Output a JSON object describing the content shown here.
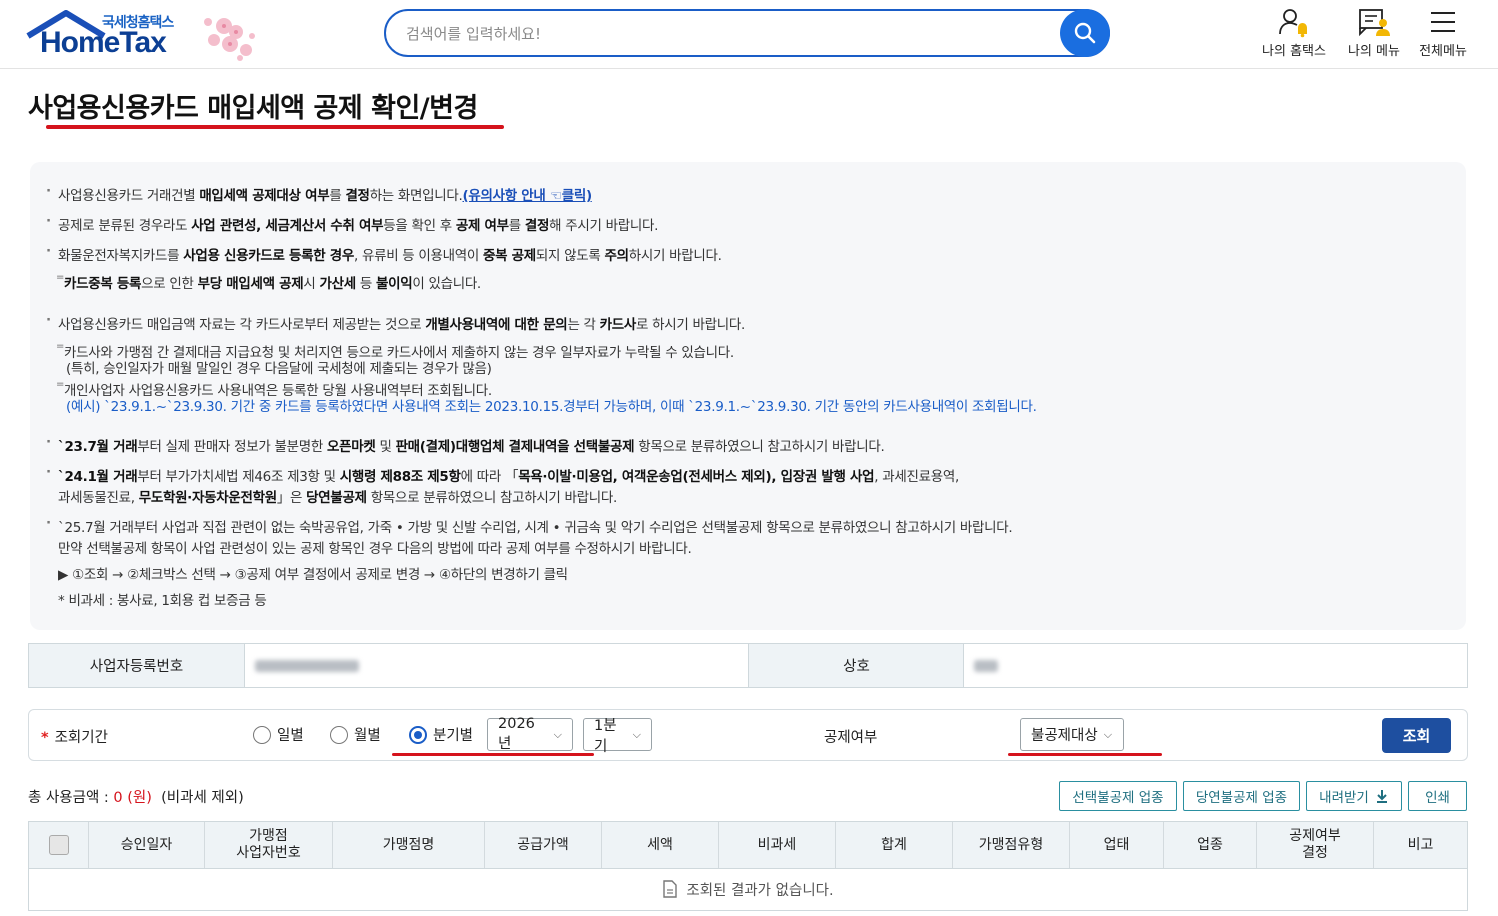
{
  "header": {
    "logo_small": "국세청홈택스",
    "logo_big": "HomeTax",
    "search_placeholder": "검색어를 입력하세요!",
    "nav": [
      {
        "label": "나의 홈택스",
        "icon": "user-bell-icon"
      },
      {
        "label": "나의 메뉴",
        "icon": "my-menu-icon"
      },
      {
        "label": "전체메뉴",
        "icon": "hamburger-menu-icon"
      }
    ]
  },
  "page": {
    "title": "사업용신용카드 매입세액 공제 확인/변경"
  },
  "notice": {
    "l1_a": "사업용신용카드 거래건별 ",
    "l1_b": "매입세액 공제대상 여부",
    "l1_c": "를 ",
    "l1_d": "결정",
    "l1_e": "하는 화면입니다.",
    "l1_link": "(유의사항 안내 ☜클릭)",
    "l2_a": "공제로 분류된 경우라도 ",
    "l2_b": "사업 관련성, 세금계산서 수취 여부",
    "l2_c": "등을 확인 후 ",
    "l2_d": "공제 여부",
    "l2_e": "를 ",
    "l2_f": "결정",
    "l2_g": "해 주시기 바랍니다.",
    "l3_a": "화물운전자복지카드를 ",
    "l3_b": "사업용 신용카드로 등록한 경우",
    "l3_c": ", 유류비 등 이용내역이 ",
    "l3_d": "중복 공제",
    "l3_e": "되지 않도록 ",
    "l3_f": "주의",
    "l3_g": "하시기 바랍니다.",
    "l4_a": "카드중복 등록",
    "l4_b": "으로 인한 ",
    "l4_c": "부당 매입세액 공제",
    "l4_d": "시 ",
    "l4_e": "가산세",
    "l4_f": " 등 ",
    "l4_g": "불이익",
    "l4_h": "이 있습니다.",
    "l5_a": "사업용신용카드 매입금액 자료는 각 카드사로부터 제공받는 것으로 ",
    "l5_b": "개별사용내역에 대한 문의",
    "l5_c": "는 각 ",
    "l5_d": "카드사",
    "l5_e": "로 하시기 바랍니다.",
    "l6": "카드사와 가맹점 간 결제대금 지급요청 및 처리지연 등으로 카드사에서 제출하지 않는 경우 일부자료가 누락될 수 있습니다.",
    "l7": "(특히, 승인일자가 매월 말일인 경우 다음달에 국세청에 제출되는 경우가 많음)",
    "l8": "개인사업자 사업용신용카드 사용내역은 등록한 당월 사용내역부터 조회됩니다.",
    "l9": "(예시) `23.9.1.~`23.9.30. 기간 중 카드를 등록하였다면 사용내역 조회는 2023.10.15.경부터 가능하며, 이때 `23.9.1.~`23.9.30. 기간 동안의 카드사용내역이 조회됩니다.",
    "l10_a": "`23.7월 거래",
    "l10_b": "부터 실제 판매자 정보가 불분명한 ",
    "l10_c": "오픈마켓",
    "l10_d": " 및 ",
    "l10_e": "판매(결제)대행업체 결제내역을 선택불공제",
    "l10_f": " 항목으로 분류하였으니 참고하시기 바랍니다.",
    "l11_a": "`24.1월 거래",
    "l11_b": "부터 부가가치세법 제46조 제3항 및 ",
    "l11_c": "시행령 제88조 제5항",
    "l11_d": "에 따라 「",
    "l11_e": "목욕·이발·미용업, 여객운송업(전세버스 제외), 입장권 발행 사업",
    "l11_f": ", 과세진료용역,",
    "l12_a": "과세동물진료, ",
    "l12_b": "무도학원·자동차운전학원",
    "l12_c": "」은 ",
    "l12_d": "당연불공제",
    "l12_e": " 항목으로 분류하였으니 참고하시기 바랍니다.",
    "l13": "`25.7월 거래부터 사업과 직접 관련이 없는 숙박공유업, 가죽 • 가방 및 신발 수리업, 시계 • 귀금속 및 악기 수리업은 선택불공제 항목으로 분류하였으니 참고하시기 바랍니다.",
    "l14": "만약 선택불공제 항목이 사업 관련성이 있는 공제 항목인 경우 다음의 방법에 따라 공제 여부를 수정하시기 바랍니다.",
    "l15": "▶ ①조회 → ②체크박스 선택 → ③공제 여부 결정에서 공제로 변경 → ④하단의 변경하기 클릭",
    "l16": "* 비과세 : 봉사료, 1회용 컵 보증금 등"
  },
  "info": {
    "biz_no_label": "사업자등록번호",
    "trade_name_label": "상호"
  },
  "query": {
    "period_label": "조회기간",
    "radio_daily": "일별",
    "radio_monthly": "월별",
    "radio_quarterly": "분기별",
    "year": "2026년",
    "quarter": "1분기",
    "deduct_label": "공제여부",
    "deduct_value": "불공제대상",
    "search_button": "조회"
  },
  "totals": {
    "label": "총 사용금액 : ",
    "amount": "0 (원)",
    "note": "(비과세 제외)"
  },
  "buttons": {
    "optional_nondeduct": "선택불공제 업종",
    "mandatory_nondeduct": "당연불공제 업종",
    "download": "내려받기",
    "print": "인쇄"
  },
  "grid": {
    "columns": [
      "승인일자",
      "가맹점\n사업자번호",
      "가맹점명",
      "공급가액",
      "세액",
      "비과세",
      "합계",
      "가맹점유형",
      "업태",
      "업종",
      "공제여부\n결정",
      "비고"
    ],
    "empty_message": "조회된 결과가 없습니다."
  },
  "colors": {
    "brand_blue": "#1a5dc7",
    "accent_red": "#d5131c",
    "search_button": "#1e4fa0"
  }
}
